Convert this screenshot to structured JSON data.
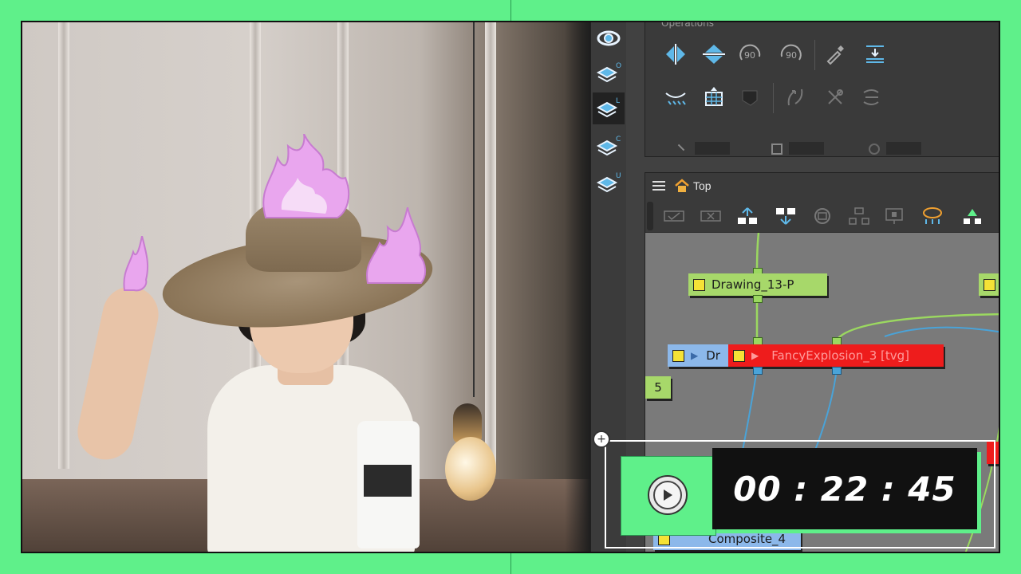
{
  "colors": {
    "frame_green": "#5ff08a",
    "node_green": "#a7d86a",
    "node_blue": "#8cb8ea",
    "node_red": "#ee1c1c",
    "port_yellow": "#f5e236"
  },
  "operations": {
    "title": "Operations",
    "row1_icons": [
      "flip-horizontal-icon",
      "flip-vertical-icon",
      "rotate-90-cw-icon",
      "rotate-90-ccw-icon",
      "eyedropper-icon",
      "align-icon"
    ],
    "row2_icons": [
      "smooth-icon",
      "flatten-icon",
      "fill-icon",
      "curve-icon",
      "cut-icon",
      "optimize-icon"
    ]
  },
  "layer_tools": [
    "view-icon",
    "layer-overlay-icon",
    "layer-line-icon",
    "layer-color-icon",
    "layer-underlay-icon"
  ],
  "layer_tool_letters": [
    "O",
    "L",
    "C",
    "U"
  ],
  "node_view": {
    "breadcrumb": "Top",
    "nodes": {
      "drawing13": "Drawing_13-P",
      "drawing_partial": "Dr",
      "fancy_explosion": "FancyExplosion_3 [tvg]",
      "composite4": "Composite_4",
      "edge_number": "5"
    }
  },
  "timer": {
    "display": "00 : 22 : 45",
    "add_symbol": "+"
  }
}
